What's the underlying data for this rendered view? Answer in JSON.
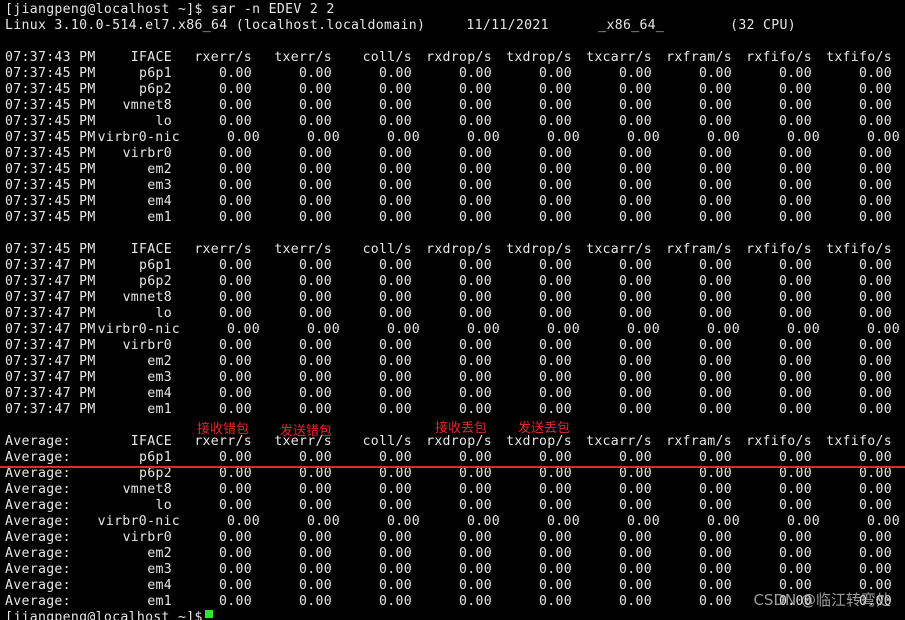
{
  "terminal": {
    "prompt_line": "[jiangpeng@localhost ~]$ sar -n EDEV 2 2",
    "sys_info_line": "Linux 3.10.0-514.el7.x86_64 (localhost.localdomain)     11/11/2021      _x86_64_        (32 CPU)",
    "final_prompt": "[jiangpeng@localhost ~]$ ",
    "columns": [
      "IFACE",
      "rxerr/s",
      "txerr/s",
      "coll/s",
      "rxdrop/s",
      "txdrop/s",
      "txcarr/s",
      "rxfram/s",
      "rxfifo/s",
      "txfifo/s"
    ],
    "blocks": [
      {
        "header_time": "07:37:43 PM",
        "row_time": "07:37:45 PM",
        "rows": [
          {
            "iface": "p6p1",
            "values": [
              "0.00",
              "0.00",
              "0.00",
              "0.00",
              "0.00",
              "0.00",
              "0.00",
              "0.00",
              "0.00"
            ]
          },
          {
            "iface": "p6p2",
            "values": [
              "0.00",
              "0.00",
              "0.00",
              "0.00",
              "0.00",
              "0.00",
              "0.00",
              "0.00",
              "0.00"
            ]
          },
          {
            "iface": "vmnet8",
            "values": [
              "0.00",
              "0.00",
              "0.00",
              "0.00",
              "0.00",
              "0.00",
              "0.00",
              "0.00",
              "0.00"
            ]
          },
          {
            "iface": "lo",
            "values": [
              "0.00",
              "0.00",
              "0.00",
              "0.00",
              "0.00",
              "0.00",
              "0.00",
              "0.00",
              "0.00"
            ]
          },
          {
            "iface": "virbr0-nic",
            "values": [
              "0.00",
              "0.00",
              "0.00",
              "0.00",
              "0.00",
              "0.00",
              "0.00",
              "0.00",
              "0.00"
            ]
          },
          {
            "iface": "virbr0",
            "values": [
              "0.00",
              "0.00",
              "0.00",
              "0.00",
              "0.00",
              "0.00",
              "0.00",
              "0.00",
              "0.00"
            ]
          },
          {
            "iface": "em2",
            "values": [
              "0.00",
              "0.00",
              "0.00",
              "0.00",
              "0.00",
              "0.00",
              "0.00",
              "0.00",
              "0.00"
            ]
          },
          {
            "iface": "em3",
            "values": [
              "0.00",
              "0.00",
              "0.00",
              "0.00",
              "0.00",
              "0.00",
              "0.00",
              "0.00",
              "0.00"
            ]
          },
          {
            "iface": "em4",
            "values": [
              "0.00",
              "0.00",
              "0.00",
              "0.00",
              "0.00",
              "0.00",
              "0.00",
              "0.00",
              "0.00"
            ]
          },
          {
            "iface": "em1",
            "values": [
              "0.00",
              "0.00",
              "0.00",
              "0.00",
              "0.00",
              "0.00",
              "0.00",
              "0.00",
              "0.00"
            ]
          }
        ]
      },
      {
        "header_time": "07:37:45 PM",
        "row_time": "07:37:47 PM",
        "rows": [
          {
            "iface": "p6p1",
            "values": [
              "0.00",
              "0.00",
              "0.00",
              "0.00",
              "0.00",
              "0.00",
              "0.00",
              "0.00",
              "0.00"
            ]
          },
          {
            "iface": "p6p2",
            "values": [
              "0.00",
              "0.00",
              "0.00",
              "0.00",
              "0.00",
              "0.00",
              "0.00",
              "0.00",
              "0.00"
            ]
          },
          {
            "iface": "vmnet8",
            "values": [
              "0.00",
              "0.00",
              "0.00",
              "0.00",
              "0.00",
              "0.00",
              "0.00",
              "0.00",
              "0.00"
            ]
          },
          {
            "iface": "lo",
            "values": [
              "0.00",
              "0.00",
              "0.00",
              "0.00",
              "0.00",
              "0.00",
              "0.00",
              "0.00",
              "0.00"
            ]
          },
          {
            "iface": "virbr0-nic",
            "values": [
              "0.00",
              "0.00",
              "0.00",
              "0.00",
              "0.00",
              "0.00",
              "0.00",
              "0.00",
              "0.00"
            ]
          },
          {
            "iface": "virbr0",
            "values": [
              "0.00",
              "0.00",
              "0.00",
              "0.00",
              "0.00",
              "0.00",
              "0.00",
              "0.00",
              "0.00"
            ]
          },
          {
            "iface": "em2",
            "values": [
              "0.00",
              "0.00",
              "0.00",
              "0.00",
              "0.00",
              "0.00",
              "0.00",
              "0.00",
              "0.00"
            ]
          },
          {
            "iface": "em3",
            "values": [
              "0.00",
              "0.00",
              "0.00",
              "0.00",
              "0.00",
              "0.00",
              "0.00",
              "0.00",
              "0.00"
            ]
          },
          {
            "iface": "em4",
            "values": [
              "0.00",
              "0.00",
              "0.00",
              "0.00",
              "0.00",
              "0.00",
              "0.00",
              "0.00",
              "0.00"
            ]
          },
          {
            "iface": "em1",
            "values": [
              "0.00",
              "0.00",
              "0.00",
              "0.00",
              "0.00",
              "0.00",
              "0.00",
              "0.00",
              "0.00"
            ]
          }
        ]
      },
      {
        "header_time": "Average:",
        "row_time": "Average:",
        "rows": [
          {
            "iface": "p6p1",
            "values": [
              "0.00",
              "0.00",
              "0.00",
              "0.00",
              "0.00",
              "0.00",
              "0.00",
              "0.00",
              "0.00"
            ]
          },
          {
            "iface": "p6p2",
            "values": [
              "0.00",
              "0.00",
              "0.00",
              "0.00",
              "0.00",
              "0.00",
              "0.00",
              "0.00",
              "0.00"
            ]
          },
          {
            "iface": "vmnet8",
            "values": [
              "0.00",
              "0.00",
              "0.00",
              "0.00",
              "0.00",
              "0.00",
              "0.00",
              "0.00",
              "0.00"
            ]
          },
          {
            "iface": "lo",
            "values": [
              "0.00",
              "0.00",
              "0.00",
              "0.00",
              "0.00",
              "0.00",
              "0.00",
              "0.00",
              "0.00"
            ]
          },
          {
            "iface": "virbr0-nic",
            "values": [
              "0.00",
              "0.00",
              "0.00",
              "0.00",
              "0.00",
              "0.00",
              "0.00",
              "0.00",
              "0.00"
            ]
          },
          {
            "iface": "virbr0",
            "values": [
              "0.00",
              "0.00",
              "0.00",
              "0.00",
              "0.00",
              "0.00",
              "0.00",
              "0.00",
              "0.00"
            ]
          },
          {
            "iface": "em2",
            "values": [
              "0.00",
              "0.00",
              "0.00",
              "0.00",
              "0.00",
              "0.00",
              "0.00",
              "0.00",
              "0.00"
            ]
          },
          {
            "iface": "em3",
            "values": [
              "0.00",
              "0.00",
              "0.00",
              "0.00",
              "0.00",
              "0.00",
              "0.00",
              "0.00",
              "0.00"
            ]
          },
          {
            "iface": "em4",
            "values": [
              "0.00",
              "0.00",
              "0.00",
              "0.00",
              "0.00",
              "0.00",
              "0.00",
              "0.00",
              "0.00"
            ]
          },
          {
            "iface": "em1",
            "values": [
              "0.00",
              "0.00",
              "0.00",
              "0.00",
              "0.00",
              "0.00",
              "0.00",
              "0.00",
              "0.00"
            ]
          }
        ]
      }
    ]
  },
  "annotations": {
    "rxerr": "接收错包",
    "txerr": "发送错包",
    "rxdrop": "接收丢包",
    "txdrop": "发送丢包",
    "color": "#e0282a"
  },
  "watermark": "CSDN @临江转弯处",
  "colors": {
    "background": "#000000",
    "foreground": "#e6e6e6",
    "cursor": "#2ee82e",
    "underline": "#d32f2f"
  }
}
